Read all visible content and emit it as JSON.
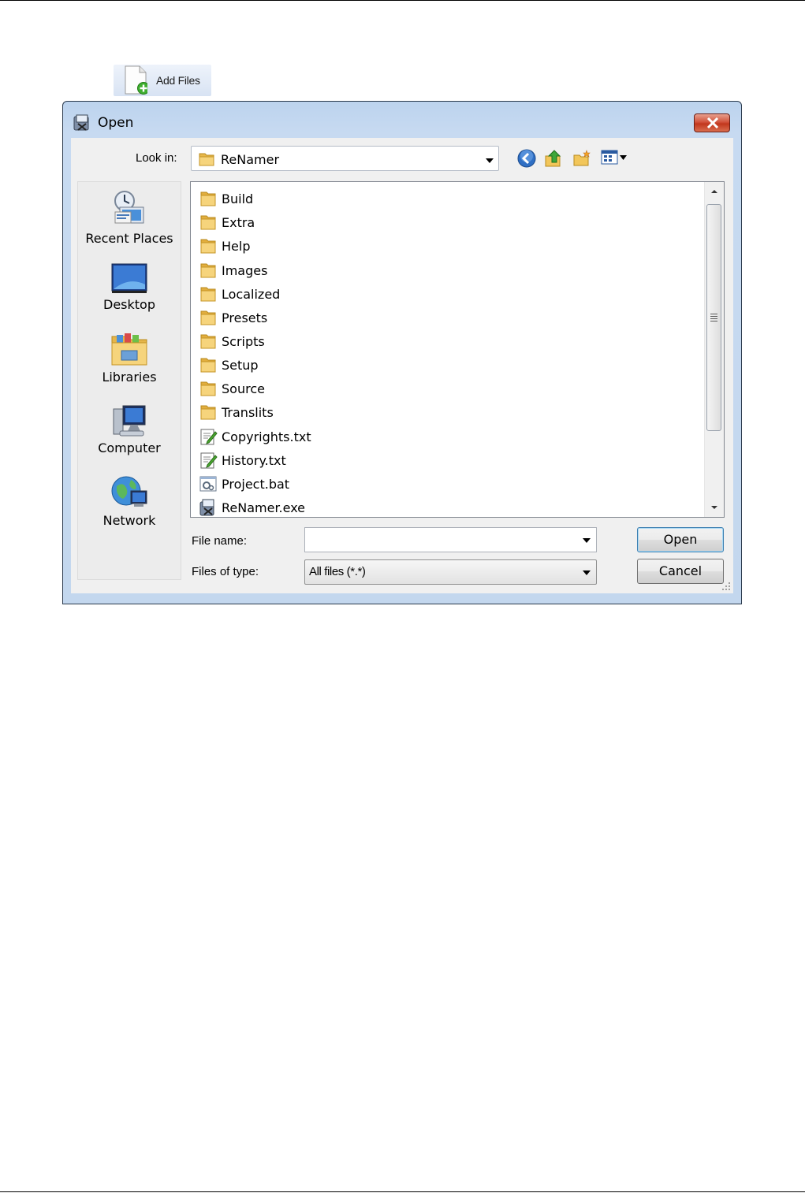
{
  "launcher": {
    "add_files_label": "Add Files"
  },
  "dialog": {
    "title": "Open",
    "look_in": {
      "label": "Look in:",
      "value": "ReNamer"
    },
    "toolbar": {
      "back": "back-icon",
      "up": "up-folder-icon",
      "new_folder": "new-folder-icon",
      "views": "view-menu-icon"
    },
    "places": [
      {
        "label": "Recent Places",
        "icon": "recent-places-icon"
      },
      {
        "label": "Desktop",
        "icon": "desktop-icon"
      },
      {
        "label": "Libraries",
        "icon": "libraries-icon"
      },
      {
        "label": "Computer",
        "icon": "computer-icon"
      },
      {
        "label": "Network",
        "icon": "network-icon"
      }
    ],
    "files": [
      {
        "name": "Build",
        "type": "folder"
      },
      {
        "name": "Extra",
        "type": "folder"
      },
      {
        "name": "Help",
        "type": "folder"
      },
      {
        "name": "Images",
        "type": "folder"
      },
      {
        "name": "Localized",
        "type": "folder"
      },
      {
        "name": "Presets",
        "type": "folder"
      },
      {
        "name": "Scripts",
        "type": "folder"
      },
      {
        "name": "Setup",
        "type": "folder"
      },
      {
        "name": "Source",
        "type": "folder"
      },
      {
        "name": "Translits",
        "type": "folder"
      },
      {
        "name": "Copyrights.txt",
        "type": "text"
      },
      {
        "name": "History.txt",
        "type": "text"
      },
      {
        "name": "Project.bat",
        "type": "batch"
      },
      {
        "name": "ReNamer.exe",
        "type": "exe"
      }
    ],
    "file_name": {
      "label": "File name:",
      "value": ""
    },
    "file_type": {
      "label": "Files of type:",
      "value": "All files (*.*)"
    },
    "buttons": {
      "open": "Open",
      "cancel": "Cancel"
    }
  }
}
